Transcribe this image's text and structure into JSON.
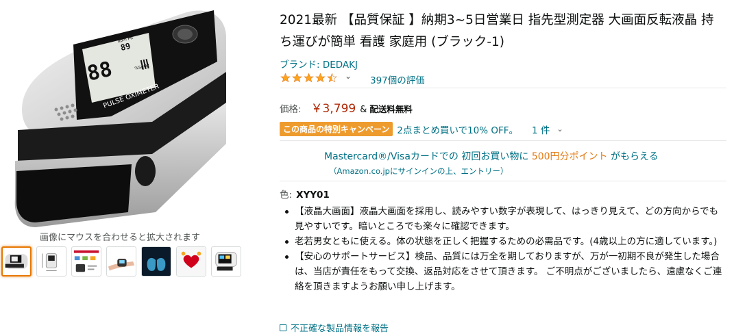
{
  "gallery": {
    "zoom_hint": "画像にマウスを合わせると拡大されます",
    "main_image_icon": "pulse-oximeter-product-photo",
    "device_screen": {
      "top_label": "bpm PR",
      "top_value": "89",
      "main_value": "88",
      "spo2_label": "%SpO2",
      "brand_label": "PULSE OXIMETER"
    },
    "thumbnails": [
      {
        "icon": "oximeter-front-thumb",
        "selected": true
      },
      {
        "icon": "oximeter-dimensions-thumb",
        "selected": false
      },
      {
        "icon": "oximeter-infographic-thumb",
        "selected": false
      },
      {
        "icon": "finger-measurement-thumb",
        "selected": false
      },
      {
        "icon": "lungs-xray-thumb",
        "selected": false
      },
      {
        "icon": "heart-care-thumb",
        "selected": false
      },
      {
        "icon": "oximeter-display-thumb",
        "selected": false
      }
    ]
  },
  "product": {
    "title": "2021最新 【品質保証 】納期3~5日営業日 指先型測定器 大画面反転液晶 持ち運びが簡単 看護 家庭用 (ブラック-1)",
    "brand": "ブランド: DEDAKJ",
    "rating": {
      "stars": 4.5,
      "count_text": "397個の評価"
    },
    "price": {
      "label": "価格:",
      "value": "￥3,799",
      "amp": "&",
      "shipping": "配送料無料"
    },
    "campaign": {
      "badge": "この商品の特別キャンペーン",
      "text": "2点まとめ買いで10% OFF。",
      "count": "1 件"
    },
    "promo": {
      "line1_prefix": "Mastercard®/Visaカードでの 初回お買い物に ",
      "line1_highlight": "500円分ポイント",
      "line1_suffix": " がもらえる",
      "line2": "（Amazon.co.jpにサインインの上、エントリー）"
    },
    "color": {
      "label": "色:",
      "value": "XYY01"
    },
    "bullets": [
      "【液晶大画面】液晶大画面を採用し、読みやすい数字が表現して、はっきり見えて、どの方向からでも見やすいです。暗いところでも楽々に確認できます。",
      "老若男女ともに使える。体の状態を正しく把握するための必需品です。(4歳以上の方に適しています。)",
      "【安心のサポートサービス】検品、品質には万全を期しておりますが、万が一初期不良が発生した場合は、当店が責任をもって交換、返品対応をさせて頂きます。 ご不明点がございましたら、遠慮なくご連絡を頂きますようお願い申し上げます。"
    ],
    "report_link": "不正確な製品情報を報告"
  },
  "colors": {
    "link": "#007185",
    "price": "#b12704",
    "star": "#ffa41c",
    "badge": "#ee9b2e",
    "promo_highlight": "#e47911",
    "selected_thumb": "#e77600"
  }
}
